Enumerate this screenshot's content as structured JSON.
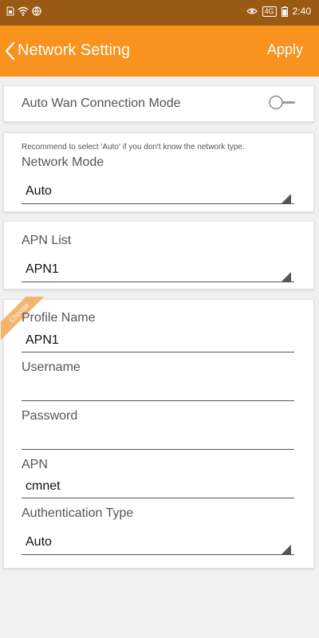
{
  "status": {
    "network": "4G",
    "time": "2:40"
  },
  "appbar": {
    "title": "Network Setting",
    "apply": "Apply"
  },
  "auto_wan": {
    "label": "Auto Wan Connection Mode",
    "enabled": false
  },
  "network_mode": {
    "hint": "Recommend to select 'Auto' if you don't know the network type.",
    "label": "Network Mode",
    "value": "Auto"
  },
  "apn_list": {
    "label": "APN List",
    "value": "APN1"
  },
  "profile": {
    "ribbon": "Choose",
    "profile_name_label": "Profile Name",
    "profile_name_value": "APN1",
    "username_label": "Username",
    "username_value": "",
    "password_label": "Password",
    "password_value": "",
    "apn_label": "APN",
    "apn_value": "cmnet",
    "auth_label": "Authentication Type",
    "auth_value": "Auto"
  }
}
